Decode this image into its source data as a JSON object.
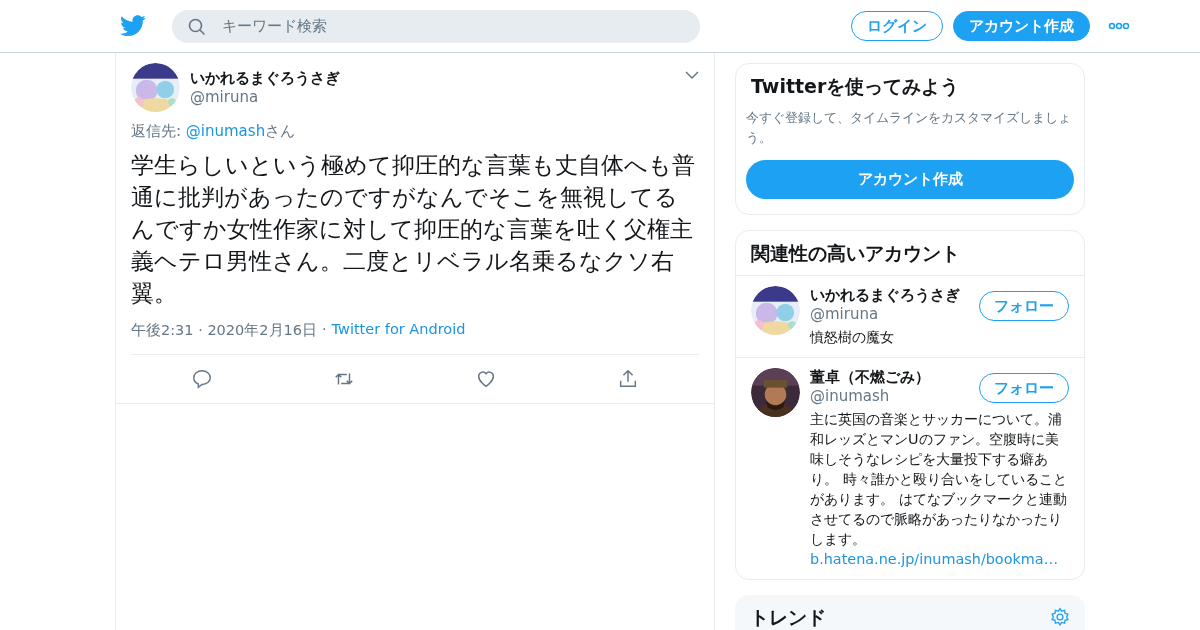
{
  "header": {
    "search": {
      "placeholder": "キーワード検索"
    },
    "buttons": [
      {
        "label": "ログイン",
        "kind": "outline"
      },
      {
        "label": "アカウント作成",
        "kind": "filled"
      }
    ]
  },
  "tweet": {
    "author": {
      "name": "いかれるまぐろうさぎ",
      "handle": "@miruna"
    },
    "reply_to": {
      "prefix": "返信先: ",
      "handle": "@inumash",
      "suffix": "さん"
    },
    "text": "学生らしいという極めて抑圧的な言葉も丈自体へも普通に批判があったのですがなんでそこを無視してるんですか女性作家に対して抑圧的な言葉を吐く父権主義ヘテロ男性さん。二度とリベラル名乗るなクソ右翼。",
    "timestamp": "午後2:31 · 2020年2月16日",
    "separator": "·",
    "source": "Twitter for Android"
  },
  "signup_card": {
    "title": "Twitterを使ってみよう",
    "text": "今すぐ登録して、タイムラインをカスタマイズしましょう。",
    "button": "アカウント作成"
  },
  "related": {
    "title": "関連性の高いアカウント",
    "accounts": [
      {
        "name": "いかれるまぐろうさぎ",
        "handle": "@miruna",
        "bio": "憤怒樹の魔女",
        "button": "フォロー"
      },
      {
        "name": "董卓（不燃ごみ）",
        "handle": "@inumash",
        "bio": "主に英国の音楽とサッカーについて。浦和レッズとマンUのファン。空腹時に美味しそうなレシピを大量投下する癖あり。 時々誰かと殴り合いをしていることがあります。 はてなブックマークと連動させてるので脈略があったりなかったりします。",
        "link": "b.hatena.ne.jp/inumash/bookma…",
        "button": "フォロー"
      }
    ]
  },
  "trends": {
    "title": "トレンド"
  }
}
